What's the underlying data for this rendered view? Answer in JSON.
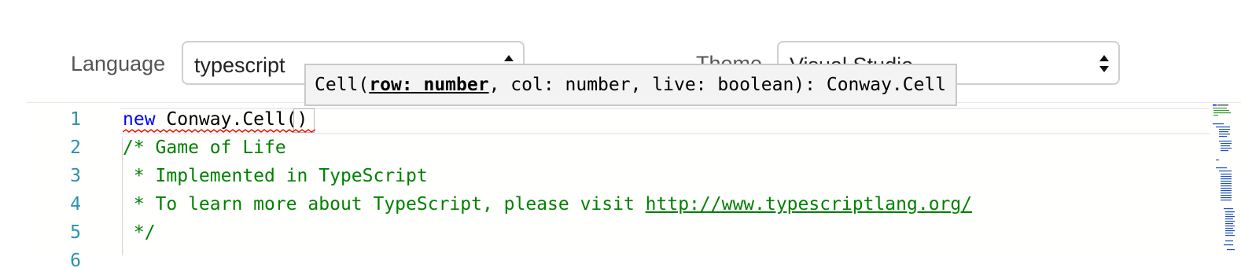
{
  "toolbar": {
    "language_label": "Language",
    "language_value": "typescript",
    "theme_label": "Theme",
    "theme_value": "Visual Studio"
  },
  "editor": {
    "line_numbers": [
      "1",
      "2",
      "3",
      "4",
      "5",
      "6"
    ],
    "lines": {
      "l1_keyword": "new",
      "l1_rest": " Conway.Cell()",
      "l2": "/* Game of Life",
      "l3": " * Implemented in TypeScript",
      "l4_prefix": " * To learn more about TypeScript, please visit ",
      "l4_url": "http://www.typescriptlang.org/",
      "l5": " */"
    }
  },
  "parameter_hint": {
    "prefix": "Cell(",
    "active_param": "row: number",
    "suffix": ", col: number, live: boolean): Conway.Cell"
  },
  "colors": {
    "keyword": "#0000ff",
    "comment": "#008000",
    "line_number": "#2b91af",
    "error_squiggle": "#e51400"
  }
}
